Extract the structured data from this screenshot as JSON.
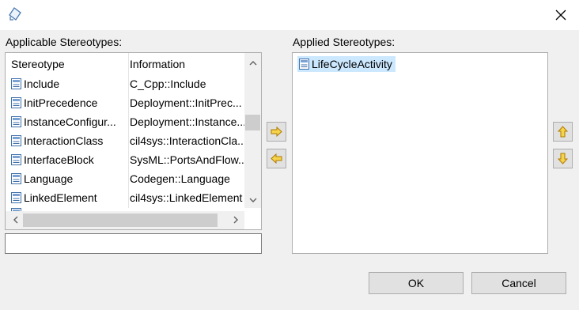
{
  "dialog": {
    "close_icon": "close-icon",
    "app_icon": "stereotype-dialog-icon"
  },
  "applicable": {
    "label": "Applicable Stereotypes:",
    "columns": [
      "Stereotype",
      "Information"
    ],
    "rows": [
      {
        "name": "Include",
        "info": "C_Cpp::Include"
      },
      {
        "name": "InitPrecedence",
        "info": "Deployment::InitPrec..."
      },
      {
        "name": "InstanceConfigur...",
        "info": "Deployment::Instance..."
      },
      {
        "name": "InteractionClass",
        "info": "cil4sys::InteractionCla..."
      },
      {
        "name": "InterfaceBlock",
        "info": "SysML::PortsAndFlow..."
      },
      {
        "name": "Language",
        "info": "Codegen::Language"
      },
      {
        "name": "LinkedElement",
        "info": "cil4sys::LinkedElement"
      }
    ],
    "filter_value": ""
  },
  "applied": {
    "label": "Applied Stereotypes:",
    "items": [
      {
        "name": "LifeCycleActivity",
        "selected": true
      }
    ]
  },
  "buttons": {
    "ok": "OK",
    "cancel": "Cancel"
  },
  "colors": {
    "arrow_fill": "#f5d34a",
    "arrow_stroke": "#b07a00",
    "selection": "#cce8ff"
  }
}
